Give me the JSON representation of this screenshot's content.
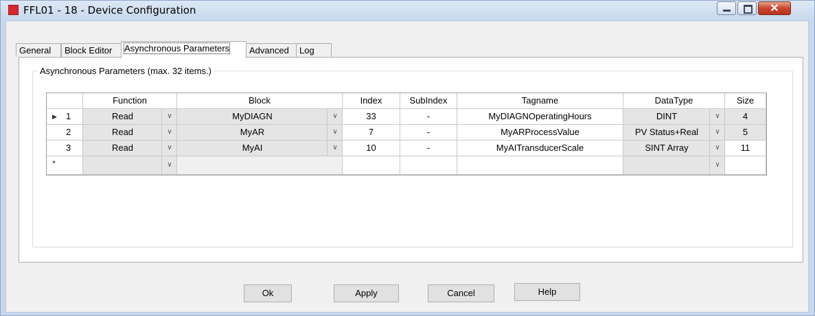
{
  "window": {
    "title": "FFL01 - 18 - Device Configuration",
    "close_glyph": "✕"
  },
  "tabs": [
    {
      "label": "General"
    },
    {
      "label": "Block Editor"
    },
    {
      "label": "Asynchronous Parameters"
    },
    {
      "label": "Advanced"
    },
    {
      "label": "Log"
    }
  ],
  "group": {
    "label": "Asynchronous Parameters (max. 32 items.)"
  },
  "grid": {
    "headers": {
      "function": "Function",
      "block": "Block",
      "index": "Index",
      "subindex": "SubIndex",
      "tagname": "Tagname",
      "datatype": "DataType",
      "size": "Size"
    },
    "rows": [
      {
        "marker": "▶",
        "num": "1",
        "function": "Read",
        "block": "MyDIAGN",
        "index": "33",
        "subindex": "-",
        "tagname": "MyDIAGNOperatingHours",
        "datatype": "DINT",
        "size": "4"
      },
      {
        "marker": "",
        "num": "2",
        "function": "Read",
        "block": "MyAR",
        "index": "7",
        "subindex": "-",
        "tagname": "MyARProcessValue",
        "datatype": "PV Status+Real",
        "size": "5"
      },
      {
        "marker": "",
        "num": "3",
        "function": "Read",
        "block": "MyAI",
        "index": "10",
        "subindex": "-",
        "tagname": "MyAITransducerScale",
        "datatype": "SINT Array",
        "size": "11"
      }
    ],
    "new_row_marker": "*",
    "dropdown_glyph": "∨"
  },
  "buttons": {
    "ok": "Ok",
    "apply": "Apply",
    "cancel": "Cancel",
    "help": "Help"
  },
  "icons": {
    "app": "app-icon",
    "minimize": "minimize-icon",
    "maximize": "maximize-icon",
    "close": "close-icon",
    "row_pointer": "row-pointer-icon",
    "dropdown": "chevron-down-icon"
  }
}
